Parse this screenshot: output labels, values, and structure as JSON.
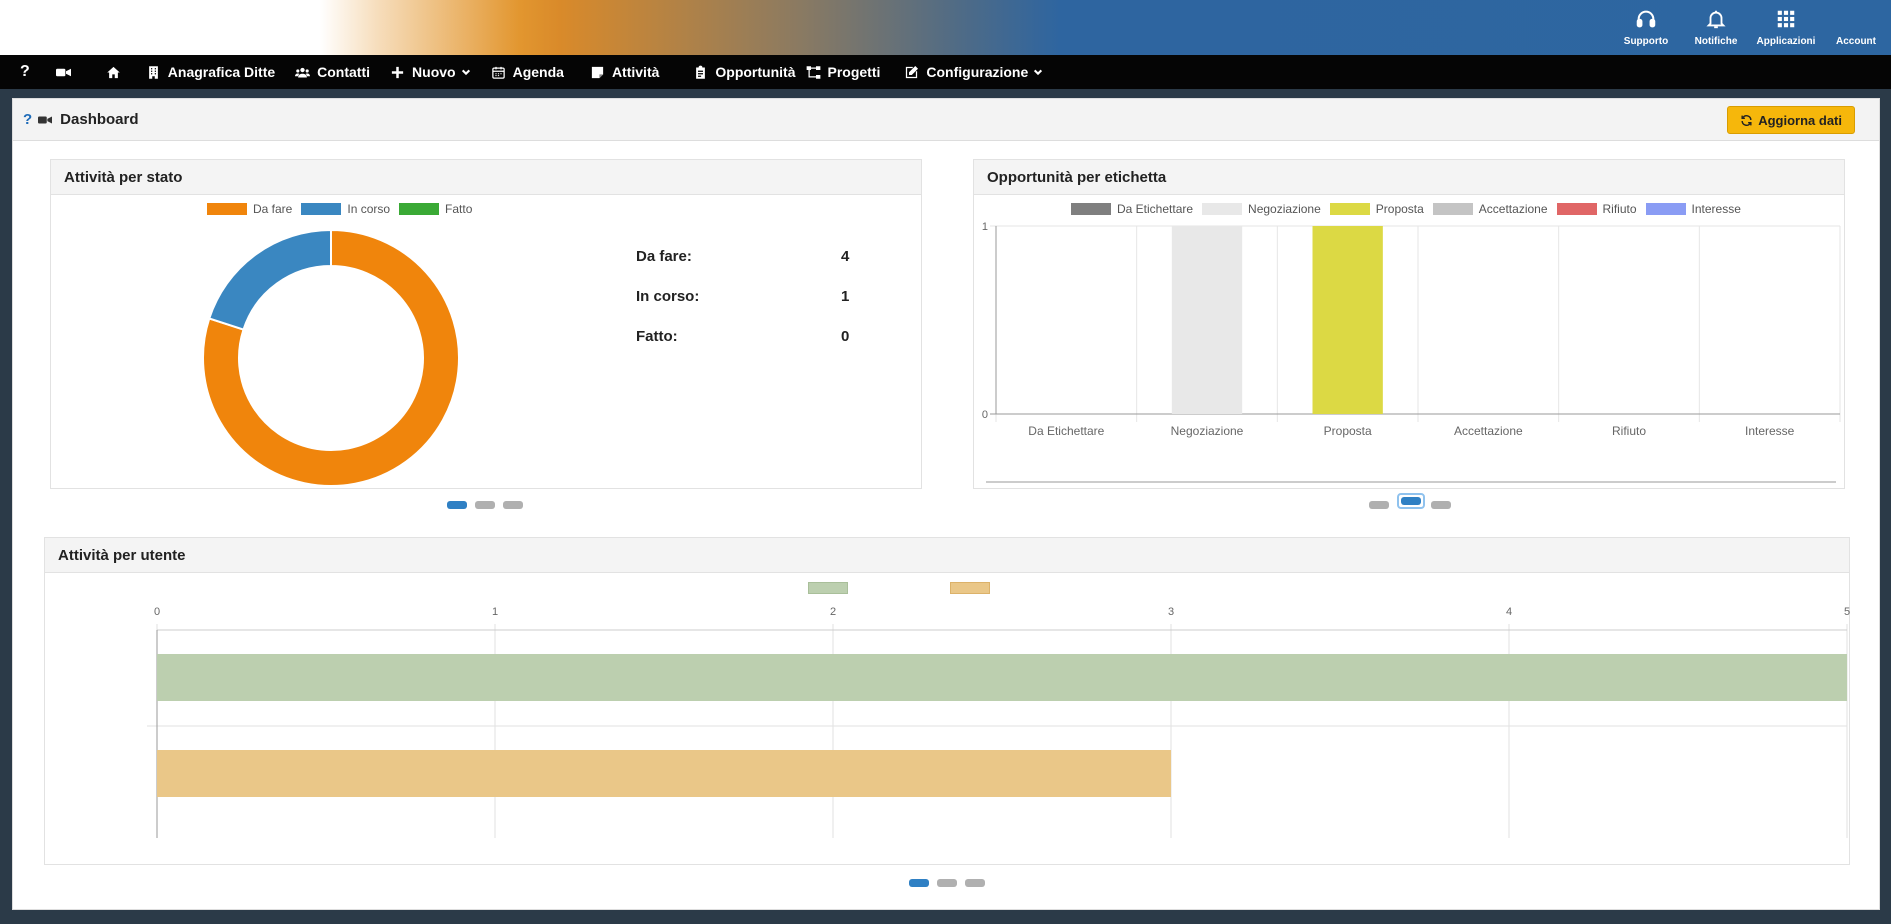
{
  "topbar": {
    "items": [
      {
        "label": "Supporto",
        "icon": "headset-icon"
      },
      {
        "label": "Notifiche",
        "icon": "bell-icon"
      },
      {
        "label": "Applicazioni",
        "icon": "apps-grid-icon"
      },
      {
        "label": "Account",
        "icon": "user-icon"
      }
    ]
  },
  "nav": {
    "help": "?",
    "items": [
      {
        "label": "",
        "icon": "video-icon"
      },
      {
        "label": "",
        "icon": "home-icon"
      },
      {
        "label": "Anagrafica Ditte",
        "icon": "building-icon"
      },
      {
        "label": "Contatti",
        "icon": "users-icon"
      },
      {
        "label": "Nuovo",
        "icon": "plus-icon",
        "dropdown": true
      },
      {
        "label": "Agenda",
        "icon": "calendar-icon"
      },
      {
        "label": "Attività",
        "icon": "note-icon"
      },
      {
        "label": "Opportunità",
        "icon": "clipboard-icon"
      },
      {
        "label": "Progetti",
        "icon": "sitemap-icon"
      },
      {
        "label": "Configurazione",
        "icon": "edit-icon",
        "dropdown": true
      }
    ]
  },
  "dashboard": {
    "help": "?",
    "title": "Dashboard",
    "refresh_label": "Aggiorna dati"
  },
  "cards": {
    "status": {
      "title": "Attività per stato",
      "legend": [
        {
          "label": "Da fare",
          "color": "#f0850c"
        },
        {
          "label": "In corso",
          "color": "#3a87c1"
        },
        {
          "label": "Fatto",
          "color": "#3aa935"
        }
      ],
      "stats": [
        {
          "label": "Da fare:",
          "value": "4"
        },
        {
          "label": "In corso:",
          "value": "1"
        },
        {
          "label": "Fatto:",
          "value": "0"
        }
      ]
    },
    "tags": {
      "title": "Opportunità per etichetta",
      "legend": [
        {
          "label": "Da Etichettare",
          "color": "#7f7f7f"
        },
        {
          "label": "Negoziazione",
          "color": "#e8e8e8"
        },
        {
          "label": "Proposta",
          "color": "#dcd944"
        },
        {
          "label": "Accettazione",
          "color": "#c4c4c4"
        },
        {
          "label": "Rifiuto",
          "color": "#e06666"
        },
        {
          "label": "Interesse",
          "color": "#8a9cf4"
        }
      ]
    },
    "users": {
      "title": "Attività per utente",
      "legend_colors": [
        "#bccfaf",
        "#eac788"
      ]
    }
  },
  "chart_data": [
    {
      "type": "pie",
      "title": "Attività per stato",
      "categories": [
        "Da fare",
        "In corso",
        "Fatto"
      ],
      "values": [
        4,
        1,
        0
      ],
      "colors": [
        "#f0850c",
        "#3a87c1",
        "#3aa935"
      ],
      "donut": true,
      "legend": "top"
    },
    {
      "type": "bar",
      "title": "Opportunità per etichetta",
      "categories": [
        "Da Etichettare",
        "Negoziazione",
        "Proposta",
        "Accettazione",
        "Rifiuto",
        "Interesse"
      ],
      "values": [
        0,
        1,
        1,
        0,
        0,
        0
      ],
      "colors": [
        "#7f7f7f",
        "#e8e8e8",
        "#dcd944",
        "#c4c4c4",
        "#e06666",
        "#8a9cf4"
      ],
      "ylim": [
        0,
        1
      ],
      "yticks": [
        "0",
        "1"
      ],
      "grid": true,
      "legend": "top"
    },
    {
      "type": "bar",
      "orientation": "horizontal",
      "title": "Attività per utente",
      "series": [
        {
          "values": [
            5
          ],
          "color": "#bccfaf"
        },
        {
          "values": [
            3
          ],
          "color": "#eac788"
        }
      ],
      "xlim": [
        0,
        5
      ],
      "xticks": [
        "0",
        "1",
        "2",
        "3",
        "4",
        "5"
      ],
      "grid": true,
      "legend": "top"
    }
  ]
}
